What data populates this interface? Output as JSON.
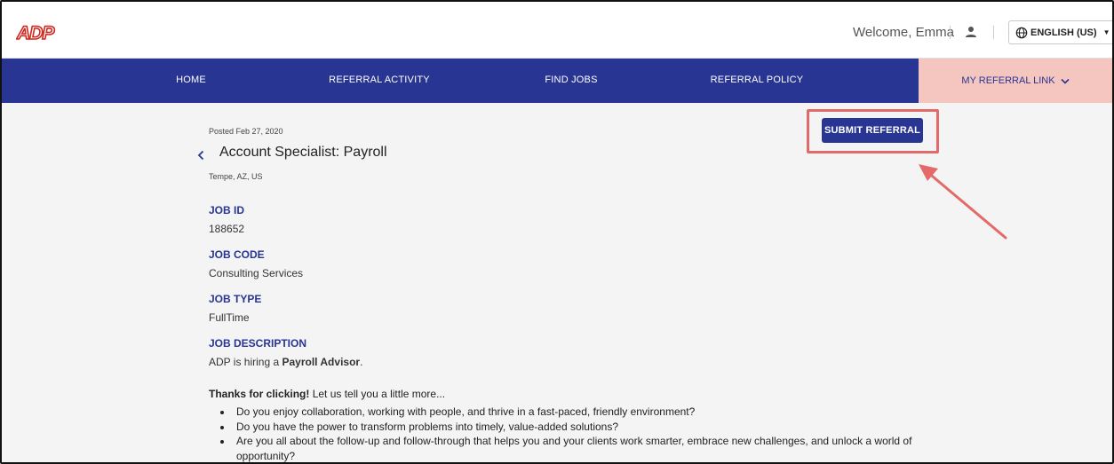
{
  "header": {
    "welcome": "Welcome, Emma",
    "language": "ENGLISH (US)"
  },
  "nav": {
    "items": [
      {
        "label": "HOME"
      },
      {
        "label": "REFERRAL ACTIVITY"
      },
      {
        "label": "FIND JOBS"
      },
      {
        "label": "REFERRAL POLICY"
      }
    ],
    "referral_link": "MY REFERRAL LINK"
  },
  "job": {
    "posted": "Posted Feb 27, 2020",
    "title": "Account Specialist: Payroll",
    "location": "Tempe, AZ, US",
    "fields": [
      {
        "label": "JOB ID",
        "value": "188652"
      },
      {
        "label": "JOB CODE",
        "value": "Consulting Services"
      },
      {
        "label": "JOB TYPE",
        "value": "FullTime"
      }
    ],
    "description_label": "JOB DESCRIPTION",
    "hiring_prefix": "ADP is hiring a ",
    "hiring_role": "Payroll Advisor",
    "hiring_suffix": ".",
    "intro_bold": "Thanks for clicking!",
    "intro_rest": " Let us tell you a little more...",
    "bullets": [
      "Do you enjoy collaboration, working with people, and thrive in a fast-paced, friendly environment?",
      "Do you have the power to transform problems into timely, value-added solutions?",
      "Are you all about the follow-up and follow-through that helps you and your clients work smarter, embrace new challenges, and unlock a world of opportunity?"
    ]
  },
  "actions": {
    "submit_referral": "SUBMIT REFERRAL"
  },
  "colors": {
    "brand_red": "#d0271d",
    "nav_blue": "#283593",
    "referral_link_bg": "#f4c6bf",
    "highlight": "#e46a6a"
  },
  "icons": {
    "logo": "adp-logo",
    "user": "user-icon",
    "language": "globe-icon",
    "back": "chevron-left-icon"
  }
}
